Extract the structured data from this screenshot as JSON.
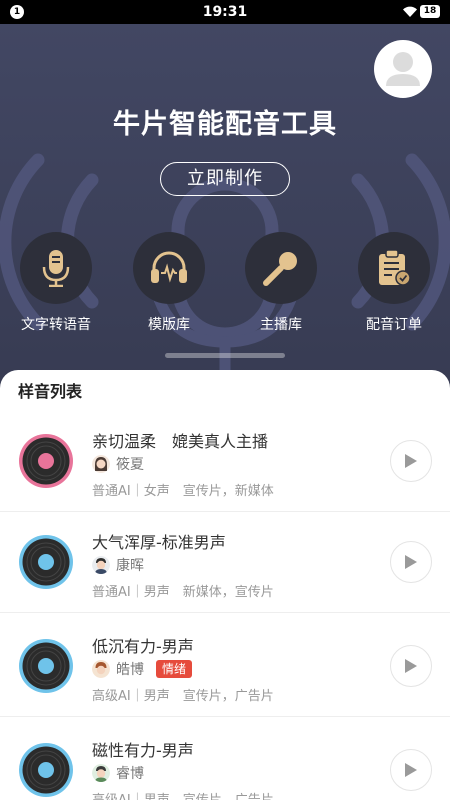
{
  "status_bar": {
    "notification_count": "1",
    "time": "19:31",
    "battery": "18"
  },
  "header": {
    "title": "牛片智能配音工具",
    "make_button": "立即制作",
    "nav": [
      {
        "label": "文字转语音",
        "icon": "microphone-icon"
      },
      {
        "label": "模版库",
        "icon": "headphones-icon"
      },
      {
        "label": "主播库",
        "icon": "karaoke-mic-icon"
      },
      {
        "label": "配音订单",
        "icon": "clipboard-check-icon"
      }
    ]
  },
  "list": {
    "title": "样音列表",
    "items": [
      {
        "name": "亲切温柔　媲美真人主播",
        "speaker": "筱夏",
        "meta": "普通AI｜女声　宣传片，新媒体",
        "tag": "",
        "disc_color": "#e8749a",
        "center_color": "#e8749a"
      },
      {
        "name": "大气浑厚-标准男声",
        "speaker": "康晖",
        "meta": "普通AI｜男声　新媒体，宣传片",
        "tag": "",
        "disc_color": "#6fc3ea",
        "center_color": "#6fc3ea"
      },
      {
        "name": "低沉有力-男声",
        "speaker": "皓博",
        "meta": "高级AI｜男声　宣传片，广告片",
        "tag": "情绪",
        "disc_color": "#6fc3ea",
        "center_color": "#6fc3ea"
      },
      {
        "name": "磁性有力-男声",
        "speaker": "睿博",
        "meta": "高级AI｜男声　宣传片，广告片",
        "tag": "",
        "disc_color": "#6fc3ea",
        "center_color": "#6fc3ea"
      }
    ]
  },
  "colors": {
    "header_bg": "#3e4259",
    "nav_circle": "#2d2f3a",
    "icon_gold": "#e3c38f",
    "tag_red": "#e64b3c"
  }
}
